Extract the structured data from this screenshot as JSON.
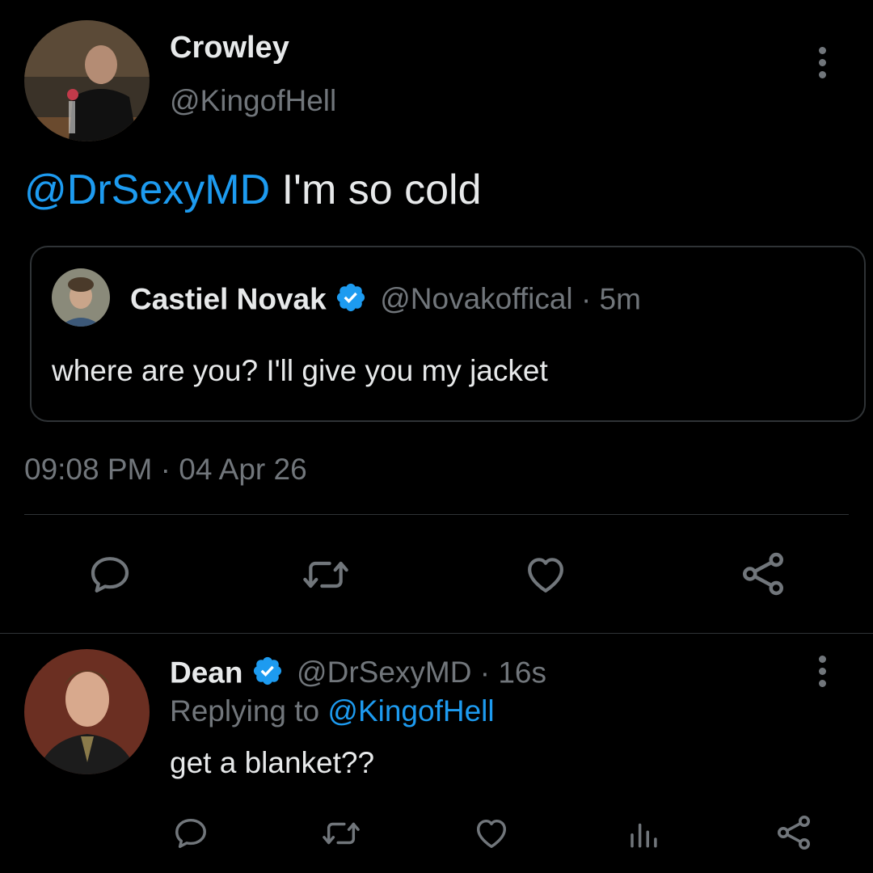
{
  "tweet": {
    "author_name": "Crowley",
    "author_handle": "@KingofHell",
    "mention": "@DrSexyMD",
    "text": " I'm so cold",
    "timestamp": "09:08 PM · 04 Apr 26"
  },
  "quoted": {
    "author_name": "Castiel Novak",
    "author_handle": "@Novakoffical",
    "time": "· 5m",
    "text": "where are you? I'll give you my jacket"
  },
  "actions": {
    "reply_icon": "reply-icon",
    "retweet_icon": "retweet-icon",
    "like_icon": "heart-icon",
    "share_icon": "share-icon"
  },
  "reply": {
    "author_name": "Dean",
    "author_handle": "@DrSexyMD",
    "time": "· 16s",
    "replying_prefix": "Replying to ",
    "replying_handle": "@KingofHell",
    "text": "get a blanket??"
  },
  "colors": {
    "background": "#000000",
    "accent": "#1d9bf0",
    "muted": "#71767b",
    "text": "#e7e9ea",
    "divider": "#2f3336"
  }
}
